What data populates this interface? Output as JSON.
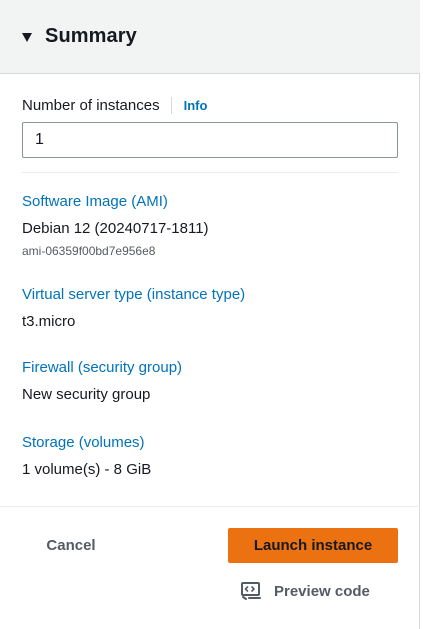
{
  "summary": {
    "title": "Summary",
    "number_of_instances_label": "Number of instances",
    "info_link": "Info",
    "number_of_instances_value": "1",
    "software_image": {
      "heading": "Software Image (AMI)",
      "value": "Debian 12 (20240717-1811)",
      "ami_id": "ami-06359f00bd7e956e8"
    },
    "instance_type": {
      "heading": "Virtual server type (instance type)",
      "value": "t3.micro"
    },
    "firewall": {
      "heading": "Firewall (security group)",
      "value": "New security group"
    },
    "storage": {
      "heading": "Storage (volumes)",
      "value": "1 volume(s) - 8 GiB"
    }
  },
  "actions": {
    "cancel_label": "Cancel",
    "launch_label": "Launch instance",
    "preview_label": "Preview code",
    "preview_icon": "code-preview-icon"
  },
  "colors": {
    "link": "#0073bb",
    "primary_button": "#ec7211",
    "header_bg": "#f2f3f3"
  }
}
